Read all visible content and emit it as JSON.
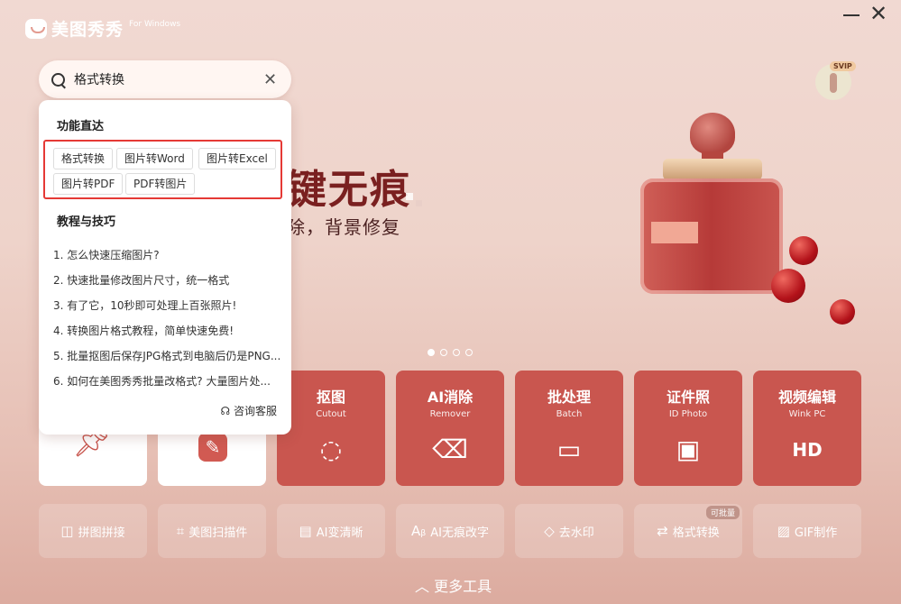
{
  "app": {
    "name": "美图秀秀",
    "platform": "For Windows"
  },
  "window": {
    "minimize_icon": "minimize-icon",
    "close_icon": "close-icon",
    "close_glyph": "✕"
  },
  "search": {
    "value": "格式转换",
    "clear_glyph": "✕"
  },
  "user": {
    "badge": "SVIP"
  },
  "banner": {
    "title": "键无痕",
    "subtitle": "除，背景修复",
    "slides": 4,
    "active_slide": 1
  },
  "dropdown": {
    "section1_title": "功能直达",
    "features": [
      "格式转换",
      "图片转Word",
      "图片转Excel",
      "图片转PDF",
      "PDF转图片"
    ],
    "section2_title": "教程与技巧",
    "tips": [
      "1. 怎么快速压缩图片?",
      "2. 快速批量修改图片尺寸，统一格式",
      "3. 有了它，10秒即可处理上百张照片!",
      "4. 转换图片格式教程，简单快速免费!",
      "5. 批量抠图后保存JPG格式到电脑后仍是PNG...",
      "6. 如何在美图秀秀批量改格式? 大量图片处..."
    ],
    "service": "咨询客服"
  },
  "tiles": [
    {
      "title": "抠图",
      "sub": "Cutout",
      "icon": "cutout-icon",
      "glyph": "◌"
    },
    {
      "title": "AI消除",
      "sub": "Remover",
      "icon": "eraser-icon",
      "glyph": "⌫"
    },
    {
      "title": "批处理",
      "sub": "Batch",
      "icon": "folder-icon",
      "glyph": "▭"
    },
    {
      "title": "证件照",
      "sub": "ID Photo",
      "icon": "id-card-icon",
      "glyph": "▣"
    },
    {
      "title": "视频编辑",
      "sub": "Wink PC",
      "icon": "hd-video-icon",
      "glyph": "HD"
    }
  ],
  "tools": [
    {
      "label": "拼图拼接",
      "icon": "collage-icon",
      "glyph": "◫"
    },
    {
      "label": "美图扫描件",
      "icon": "scan-icon",
      "glyph": "⌗"
    },
    {
      "label": "AI变清晰",
      "icon": "hd-icon",
      "glyph": "▤"
    },
    {
      "label": "AI无痕改字",
      "icon": "text-edit-icon",
      "glyph": "Aᵦ"
    },
    {
      "label": "去水印",
      "icon": "watermark-eraser-icon",
      "glyph": "◇"
    },
    {
      "label": "格式转换",
      "icon": "convert-icon",
      "glyph": "⇄"
    },
    {
      "label": "GIF制作",
      "icon": "gif-icon",
      "glyph": "▨"
    }
  ],
  "batch_tag": "可批量",
  "more_tools": "更多工具"
}
